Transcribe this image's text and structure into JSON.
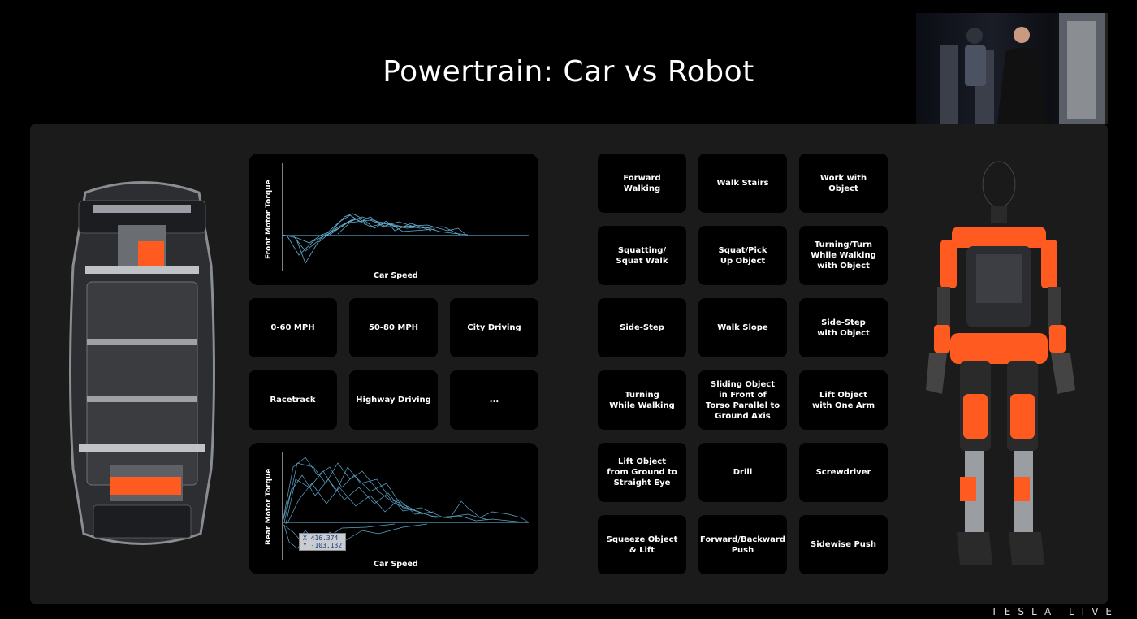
{
  "title": "Powertrain: Car vs Robot",
  "front_chart": {
    "ylabel": "Front Motor Torque",
    "xlabel": "Car Speed"
  },
  "car_scenarios": [
    "0-60 MPH",
    "50-80 MPH",
    "City Driving",
    "Racetrack",
    "Highway Driving",
    "..."
  ],
  "rear_chart": {
    "ylabel": "Rear Motor Torque",
    "xlabel": "Car Speed",
    "tooltip_x": "X 416.374",
    "tooltip_y": "Y -103.132"
  },
  "robot_tasks": [
    "Forward\nWalking",
    "Walk Stairs",
    "Work with\nObject",
    "Squatting/\nSquat Walk",
    "Squat/Pick\nUp Object",
    "Turning/Turn\nWhile Walking\nwith Object",
    "Side-Step",
    "Walk Slope",
    "Side-Step\nwith Object",
    "Turning\nWhile Walking",
    "Sliding Object\nin Front of\nTorso Parallel to\nGround Axis",
    "Lift Object\nwith One Arm",
    "Lift Object\nfrom Ground to\nStraight Eye",
    "Drill",
    "Screwdriver",
    "Squeeze Object\n& Lift",
    "Forward/Backward\nPush",
    "Sidewise Push"
  ],
  "footer": "TESLA LIVE",
  "colors": {
    "accent_orange": "#ff5a1f",
    "trace_blue": "#6ec3ea"
  }
}
